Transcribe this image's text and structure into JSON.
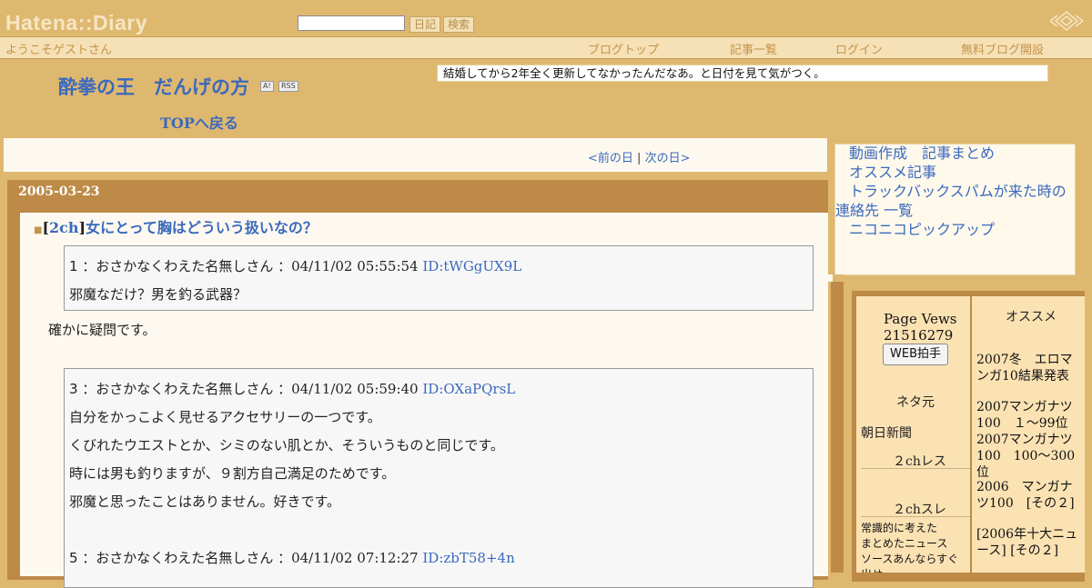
{
  "hatena_bar": {
    "logo": "Hatena::Diary",
    "diary_btn": "日記",
    "search_btn": "検索"
  },
  "welcome_bar": {
    "greeting": "ようこそゲストさん",
    "links": [
      "ブログトップ",
      "記事一覧",
      "ログイン",
      "無料ブログ開設"
    ]
  },
  "header": {
    "title": "酔拳の王　だんげの方",
    "ai_badge": "A!",
    "rss_badge": "RSS",
    "top_link": "TOPへ戻る",
    "description": "結婚してから2年全く更新してなかったんだなあ。と日付を見て気がつく。"
  },
  "calendar": {
    "prev": "<前の日",
    "sep": " | ",
    "next": "次の日>"
  },
  "day": {
    "date": "2005-03-23",
    "entry": {
      "bullet": "■",
      "bracket_open": "[",
      "category": "2ch",
      "bracket_close": "]",
      "title": "女にとって胸はどういう扱いなの？"
    },
    "posts": [
      {
        "header": "1 ：おさかなくわえた名無しさん ：",
        "datetime": "04/11/02 05:55:54 ",
        "id": "ID:tWGgUX9L",
        "lines": [
          "邪魔なだけ？男を釣る武器？"
        ]
      },
      {
        "header": "3 ：おさかなくわえた名無しさん ：",
        "datetime": "04/11/02 05:59:40 ",
        "id": "ID:OXaPQrsL",
        "lines": [
          "自分をかっこよく見せるアクセサリーの一つです。",
          "くびれたウエストとか、シミのない肌とか、そういうものと同じです。",
          "時には男も釣りますが、９割方自己満足のためです。",
          "邪魔と思ったことはありません。好きです。"
        ]
      },
      {
        "header": "5 ：おさかなくわえた名無しさん ：",
        "datetime": "04/11/02 07:12:27 ",
        "id": "ID:zbT58+4n",
        "lines": []
      }
    ],
    "comment1": "確かに疑問です。"
  },
  "sidebar": {
    "links": [
      "動画作成　記事まとめ",
      "オススメ記事",
      "トラックバックスパムが来た時の連絡先 一覧",
      "ニコニコピックアップ"
    ],
    "left": {
      "page_views_label": "Page Vews",
      "page_views": "21516279",
      "webclap": "WEB拍手",
      "neta_moto": "ネタ元",
      "asahi": "朝日新聞",
      "res": "２chレス",
      "sure": "２chスレ",
      "note": "常識的に考えた\nまとめたニュース\nソースあんならすぐ出せ"
    },
    "right": {
      "heading": "オススメ",
      "items": [
        "2007冬　エロマンガ10結果発表",
        "2007マンガナツ100　１～99位",
        "2007マンガナツ100　100～300位",
        "2006　マンガナツ100　[その２]",
        "[2006年十大ニュース] [その２]"
      ]
    }
  }
}
